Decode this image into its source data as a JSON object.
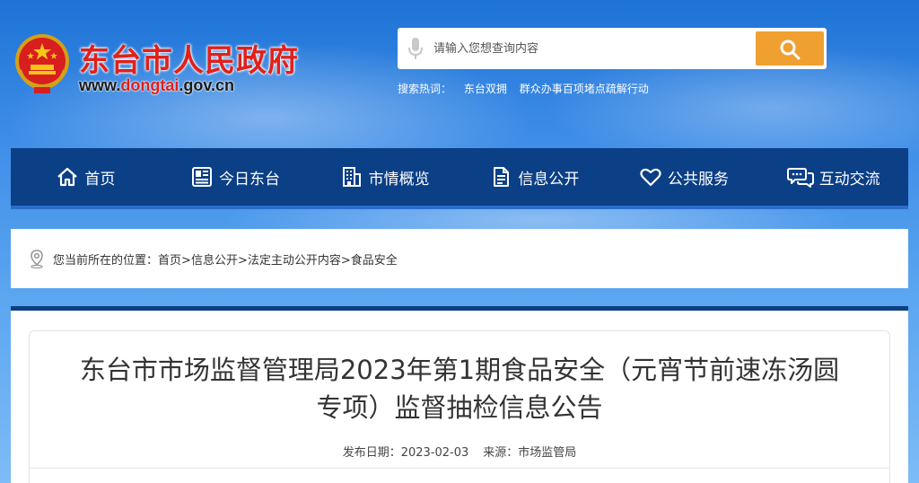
{
  "header": {
    "site_title": "东台市人民政府",
    "site_url_prefix": "www.",
    "site_url_domain": "dongtai",
    "site_url_suffix": ".gov.cn"
  },
  "search": {
    "placeholder": "请输入您想查询内容",
    "hot_label": "搜索热词：",
    "hot_words": [
      "东台双拥",
      "群众办事百项堵点疏解行动"
    ]
  },
  "nav": {
    "items": [
      {
        "label": "首页",
        "icon": "home-icon"
      },
      {
        "label": "今日东台",
        "icon": "newspaper-icon"
      },
      {
        "label": "市情概览",
        "icon": "building-icon"
      },
      {
        "label": "信息公开",
        "icon": "document-icon"
      },
      {
        "label": "公共服务",
        "icon": "heart-icon"
      },
      {
        "label": "互动交流",
        "icon": "chat-icon"
      }
    ]
  },
  "breadcrumb": {
    "prefix": "您当前所在的位置：",
    "items": [
      "首页",
      "信息公开",
      "法定主动公开内容",
      "食品安全"
    ],
    "separator": ">"
  },
  "article": {
    "title_line1": "东台市市场监督管理局2023年第1期食品安全（元宵节前速冻汤圆",
    "title_line2": "专项）监督抽检信息公告",
    "date_label": "发布日期：",
    "date": "2023-02-03",
    "source_label": "来源：",
    "source": "市场监管局"
  },
  "colors": {
    "title_red": "#e0201c",
    "nav_blue": "#0b3f86",
    "search_orange": "#f0a030"
  }
}
